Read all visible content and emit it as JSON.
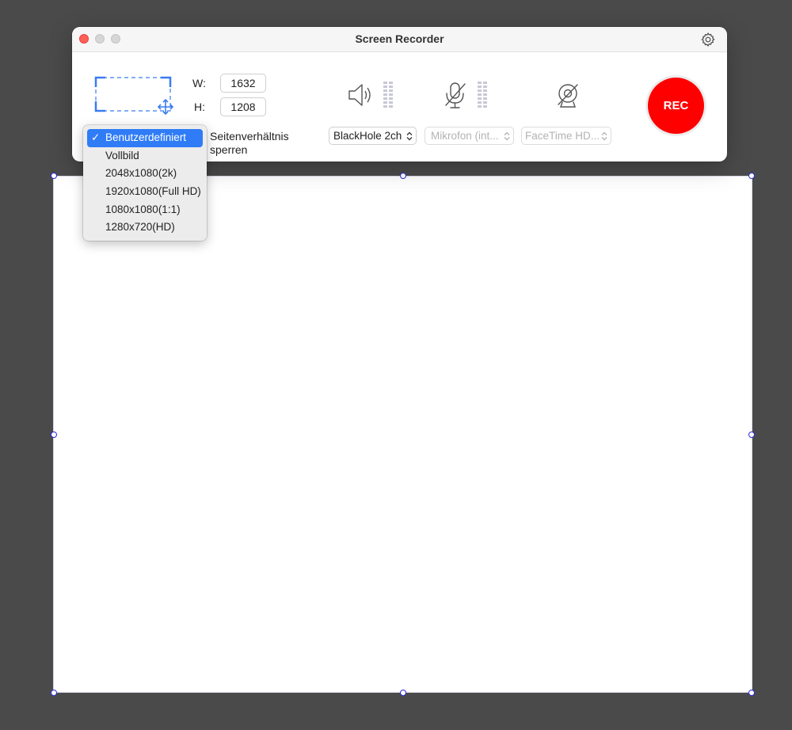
{
  "window": {
    "title": "Screen Recorder"
  },
  "dimensions": {
    "width_label": "W:",
    "height_label": "H:",
    "width_value": "1632",
    "height_value": "1208"
  },
  "aspect": {
    "label_line1": "Seitenverhältnis",
    "label_line2": "sperren"
  },
  "devices": {
    "audio_output": "BlackHole 2ch",
    "microphone": "Mikrofon (int...",
    "camera": "FaceTime HD..."
  },
  "record_button": {
    "label": "REC",
    "color": "#ff0000"
  },
  "preset_menu": {
    "check": "✓",
    "items": [
      {
        "label": "Benutzerdefiniert",
        "selected": true
      },
      {
        "label": "Vollbild"
      },
      {
        "label": "2048x1080(2k)"
      },
      {
        "label": "1920x1080(Full HD)"
      },
      {
        "label": "1080x1080(1:1)"
      },
      {
        "label": "1280x720(HD)"
      }
    ]
  },
  "colors": {
    "accent": "#2f7cf6",
    "close_button": "#fe5f57",
    "handle": "#2a2ad8",
    "backdrop": "#4a4a4a"
  },
  "icons": [
    "gear-icon",
    "region-select-icon",
    "move-arrows-icon",
    "speaker-icon",
    "microphone-muted-icon",
    "camera-off-icon",
    "level-meter-icon",
    "updown-arrows-icon",
    "check-icon"
  ]
}
